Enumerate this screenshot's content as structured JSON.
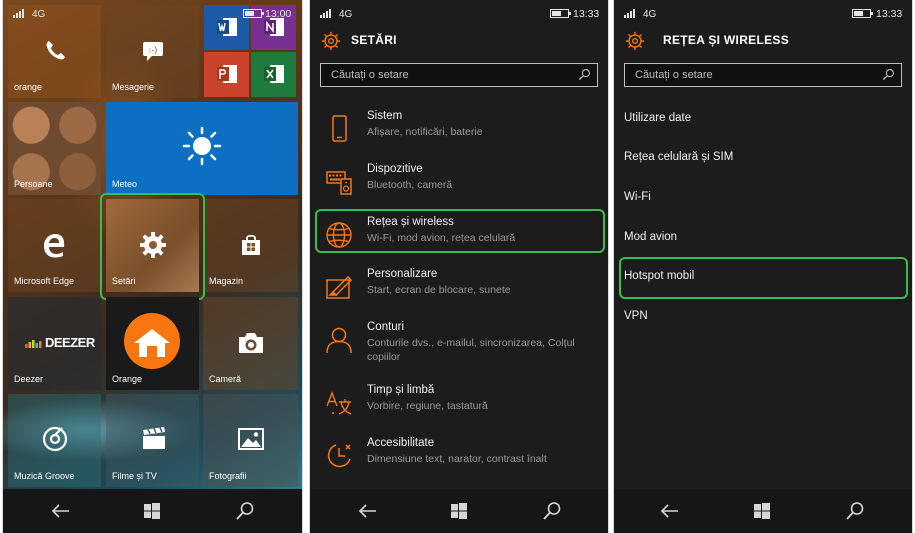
{
  "status": {
    "network": "4G",
    "time_start": "13:00",
    "time_settings": "13:33",
    "time_network": "13:33"
  },
  "start": {
    "tiles": [
      {
        "id": "phone",
        "label": "orange"
      },
      {
        "id": "messaging",
        "label": "Mesagerie"
      },
      {
        "id": "people",
        "label": "Persoane"
      },
      {
        "id": "weather",
        "label": "Meteo"
      },
      {
        "id": "edge",
        "label": "Microsoft Edge"
      },
      {
        "id": "settings",
        "label": "Setări"
      },
      {
        "id": "store",
        "label": "Magazin"
      },
      {
        "id": "deezer",
        "label": "Deezer"
      },
      {
        "id": "orange",
        "label": "Orange"
      },
      {
        "id": "camera",
        "label": "Cameră"
      },
      {
        "id": "groove",
        "label": "Muzică Groove"
      },
      {
        "id": "movies",
        "label": "Filme și TV"
      },
      {
        "id": "photos",
        "label": "Fotografii"
      }
    ],
    "deezer_logo": "DEEZER",
    "colors": {
      "highlight": "#3dbb4f",
      "accent": "#f7760f"
    }
  },
  "settings": {
    "title": "SETĂRI",
    "search_placeholder": "Căutați o setare",
    "items": [
      {
        "title": "Sistem",
        "desc": "Afișare, notificări, baterie",
        "icon": "phone-icon"
      },
      {
        "title": "Dispozitive",
        "desc": "Bluetooth, cameră",
        "icon": "devices-icon"
      },
      {
        "title": "Rețea și wireless",
        "desc": "Wi-Fi, mod avion, rețea celulară",
        "icon": "globe-icon"
      },
      {
        "title": "Personalizare",
        "desc": "Start, ecran de blocare, sunete",
        "icon": "paint-icon"
      },
      {
        "title": "Conturi",
        "desc": "Conturile dvs., e-mailul, sincronizarea, Colțul",
        "desc2": "copiilor",
        "icon": "person-icon"
      },
      {
        "title": "Timp și limbă",
        "desc": "Vorbire, regiune, tastatură",
        "icon": "time-language-icon"
      },
      {
        "title": "Accesibilitate",
        "desc": "Dimensiune text, narator, contrast înalt",
        "icon": "accessibility-icon"
      }
    ]
  },
  "network": {
    "title": "REȚEA ȘI WIRELESS",
    "search_placeholder": "Căutați o setare",
    "items": [
      "Utilizare date",
      "Rețea celulară și SIM",
      "Wi-Fi",
      "Mod avion",
      "Hotspot mobil",
      "VPN"
    ]
  }
}
